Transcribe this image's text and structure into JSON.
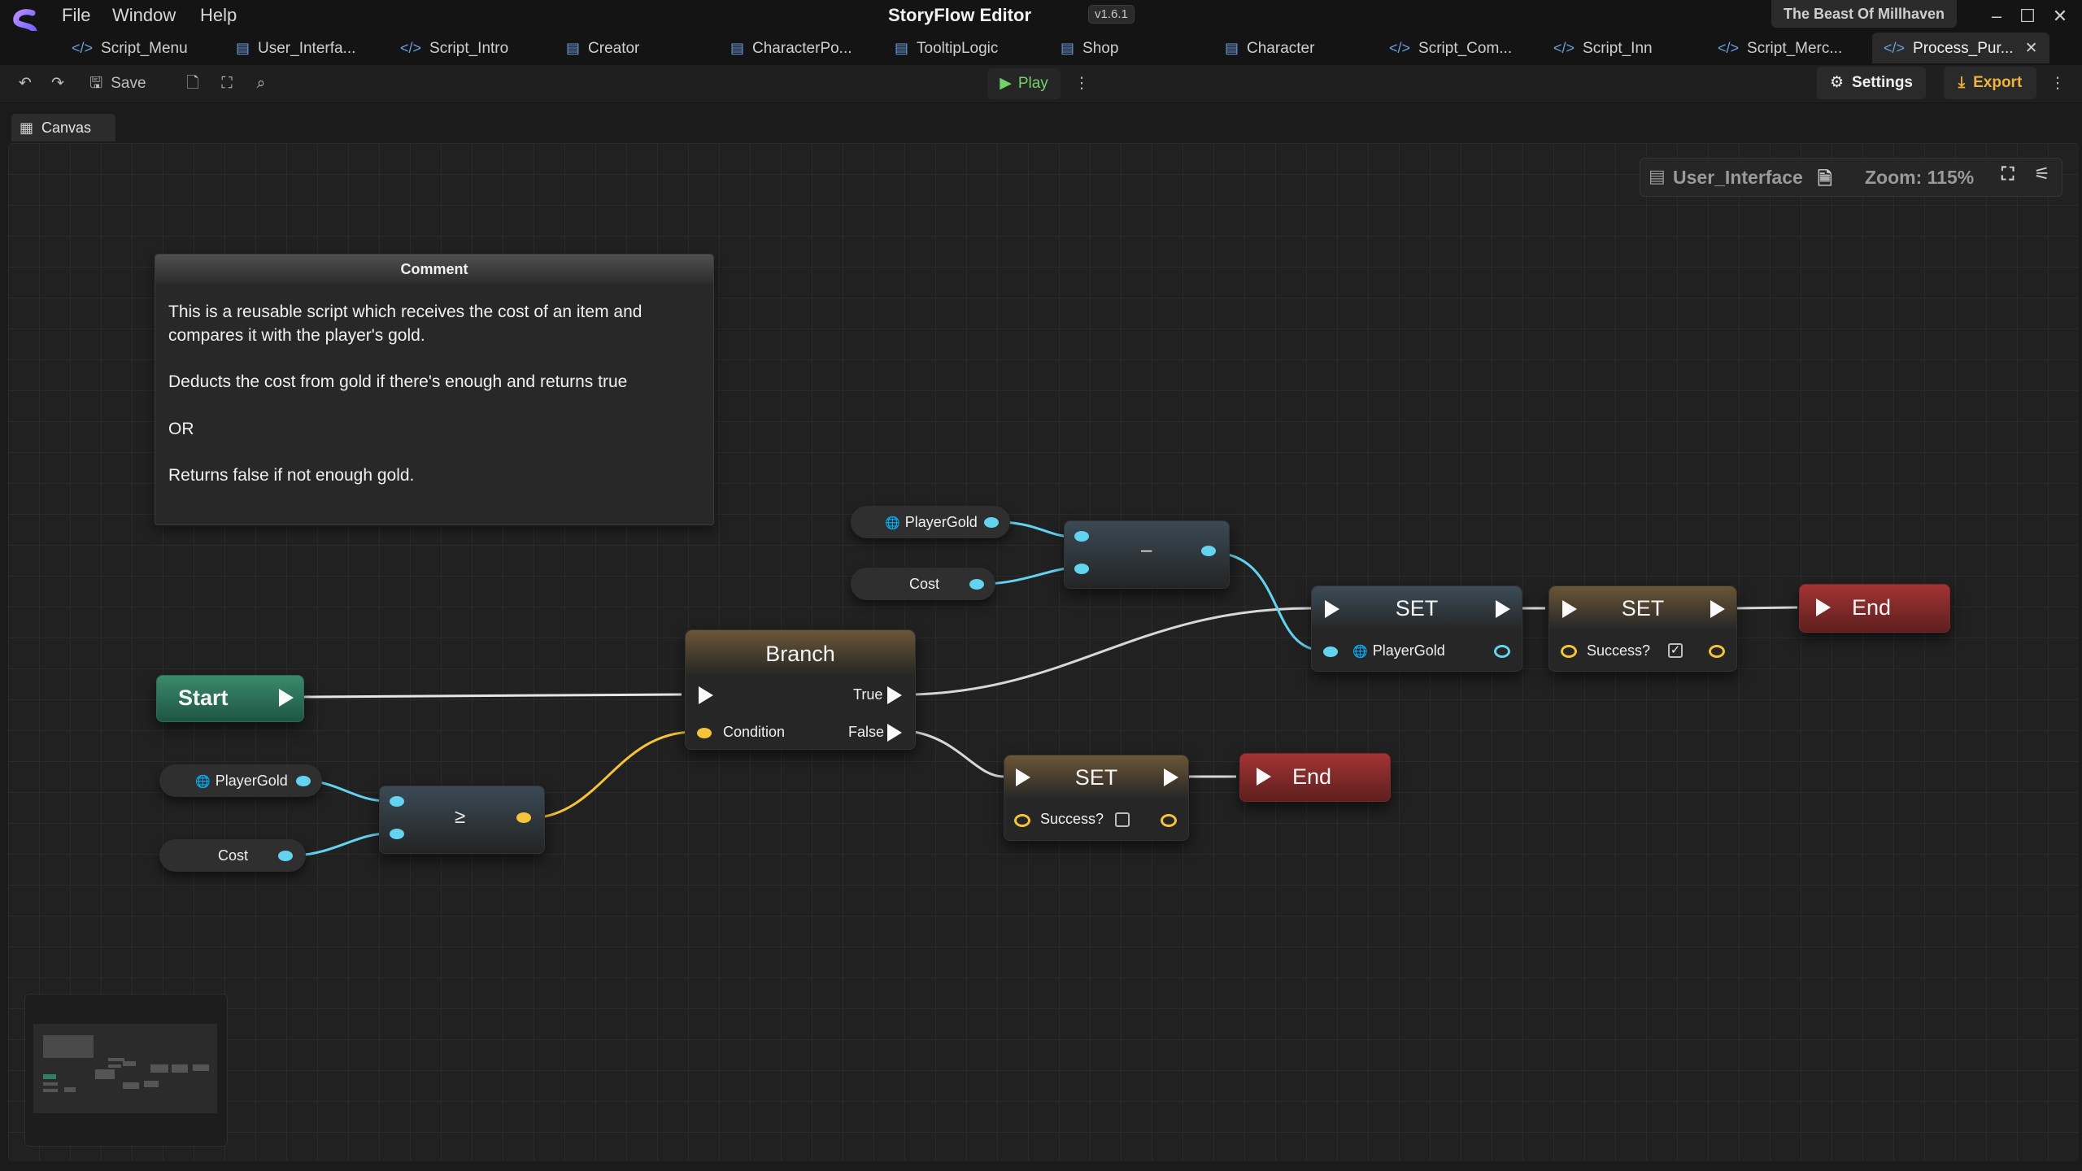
{
  "app": {
    "title": "StoryFlow Editor",
    "version": "v1.6.1",
    "project": "The Beast Of Millhaven"
  },
  "menu": [
    "File",
    "Window",
    "Help"
  ],
  "tabs": [
    {
      "label": "Script_Menu",
      "icon": "code-icon"
    },
    {
      "label": "User_Interfa...",
      "icon": "board-icon"
    },
    {
      "label": "Script_Intro",
      "icon": "code-icon"
    },
    {
      "label": "Creator",
      "icon": "board-icon"
    },
    {
      "label": "CharacterPo...",
      "icon": "board-icon"
    },
    {
      "label": "TooltipLogic",
      "icon": "board-icon"
    },
    {
      "label": "Shop",
      "icon": "board-icon"
    },
    {
      "label": "Character",
      "icon": "board-icon"
    },
    {
      "label": "Script_Com...",
      "icon": "code-icon"
    },
    {
      "label": "Script_Inn",
      "icon": "code-icon"
    },
    {
      "label": "Script_Merc...",
      "icon": "code-icon"
    },
    {
      "label": "Process_Pur...",
      "icon": "code-icon",
      "active": true
    }
  ],
  "toolbar": {
    "save": "Save",
    "play": "Play",
    "settings": "Settings",
    "export": "Export"
  },
  "canvas_tab": "Canvas",
  "info_panel": {
    "board": "User_Interface",
    "zoom": "Zoom: 115%"
  },
  "comment": {
    "header": "Comment",
    "lines": [
      "This is a reusable script which receives the cost of an item and",
      "compares it with the player's gold.",
      "Deducts the cost from gold if there's enough and returns true",
      "OR",
      "Returns false if not enough gold."
    ]
  },
  "nodes": {
    "start": "Start",
    "branch": {
      "title": "Branch",
      "true": "True",
      "false": "False",
      "condition": "Condition"
    },
    "compare_op": "≥",
    "subtract_op": "–",
    "var_player_gold": "PlayerGold",
    "var_cost": "Cost",
    "set_gold": {
      "title": "SET",
      "pin": "PlayerGold"
    },
    "set_success_true": {
      "title": "SET",
      "pin": "Success?",
      "checked": true
    },
    "set_success_false": {
      "title": "SET",
      "pin": "Success?",
      "checked": false
    },
    "end": "End"
  },
  "colors": {
    "accent_cyan": "#63d3f0",
    "accent_yellow": "#f5c43a",
    "start_green": "#2f7f60",
    "end_red": "#8e2a2a",
    "set_orange": "#8a6a33"
  }
}
